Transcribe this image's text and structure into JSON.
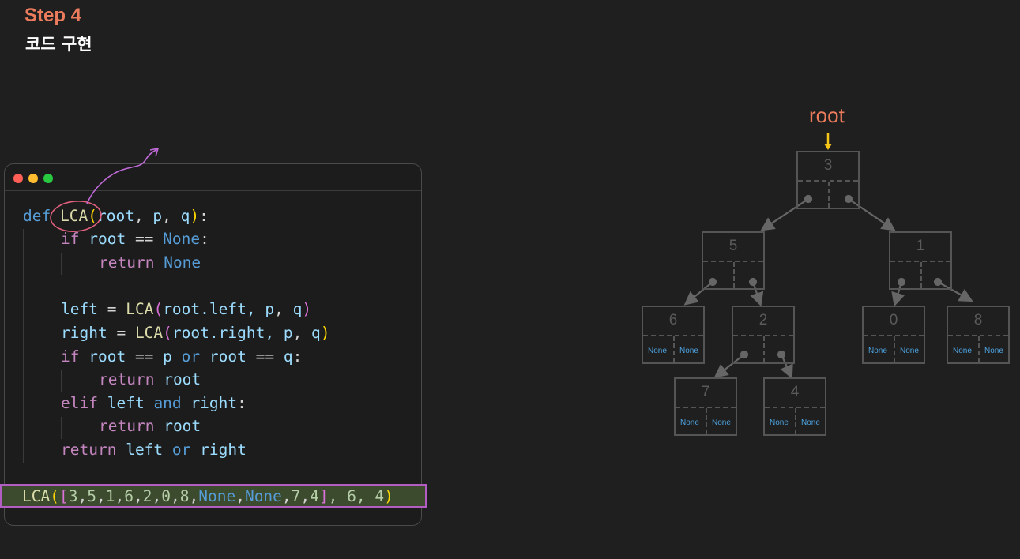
{
  "header": {
    "step": "Step 4",
    "subtitle": "코드 구현"
  },
  "editor": {
    "lines": [
      [
        "def",
        " ",
        "LCA",
        "(",
        "root",
        ", ",
        "p",
        ", ",
        "q",
        ")",
        ":"
      ],
      [
        "if",
        " ",
        "root",
        " == ",
        "None",
        ":"
      ],
      [
        "return",
        " ",
        "None"
      ],
      [],
      [
        "left",
        " = ",
        "LCA",
        "(",
        "root",
        ".left, ",
        "p",
        ", ",
        "q",
        ")"
      ],
      [
        "right",
        " = ",
        "LCA",
        "(",
        "root",
        ".right, ",
        "p",
        ", ",
        "q",
        ")"
      ],
      [
        "if",
        " ",
        "root",
        " == ",
        "p",
        " ",
        "or",
        " ",
        "root",
        " == ",
        "q",
        ":"
      ],
      [
        "return",
        " ",
        "root"
      ],
      [
        "elif",
        " ",
        "left",
        " ",
        "and",
        " ",
        "right",
        ":"
      ],
      [
        "return",
        " ",
        "root"
      ],
      [
        "return",
        " ",
        "left",
        " ",
        "or",
        " ",
        "right"
      ]
    ],
    "call": {
      "fn": "LCA",
      "open": "(",
      "list_open": "[",
      "items": [
        "3",
        "5",
        "1",
        "6",
        "2",
        "0",
        "8",
        "None",
        "None",
        "7",
        "4"
      ],
      "list_close": "]",
      "args": ", 6, 4",
      "close": ")"
    }
  },
  "tree": {
    "root_label": "root",
    "nodes": [
      {
        "id": "n3",
        "value": "3"
      },
      {
        "id": "n5",
        "value": "5"
      },
      {
        "id": "n1",
        "value": "1"
      },
      {
        "id": "n6",
        "value": "6",
        "left": "None",
        "right": "None"
      },
      {
        "id": "n2",
        "value": "2"
      },
      {
        "id": "n0",
        "value": "0",
        "left": "None",
        "right": "None"
      },
      {
        "id": "n8",
        "value": "8",
        "left": "None",
        "right": "None"
      },
      {
        "id": "n7",
        "value": "7",
        "left": "None",
        "right": "None"
      },
      {
        "id": "n4",
        "value": "4",
        "left": "None",
        "right": "None"
      }
    ]
  },
  "colors": {
    "accent": "#ec7c5c",
    "highlight_border": "#b15dc1",
    "highlight_fill": "#3c4a2e",
    "root_arrow": "#f5c518",
    "node_border": "#555555",
    "none_text": "#4da3e0"
  }
}
